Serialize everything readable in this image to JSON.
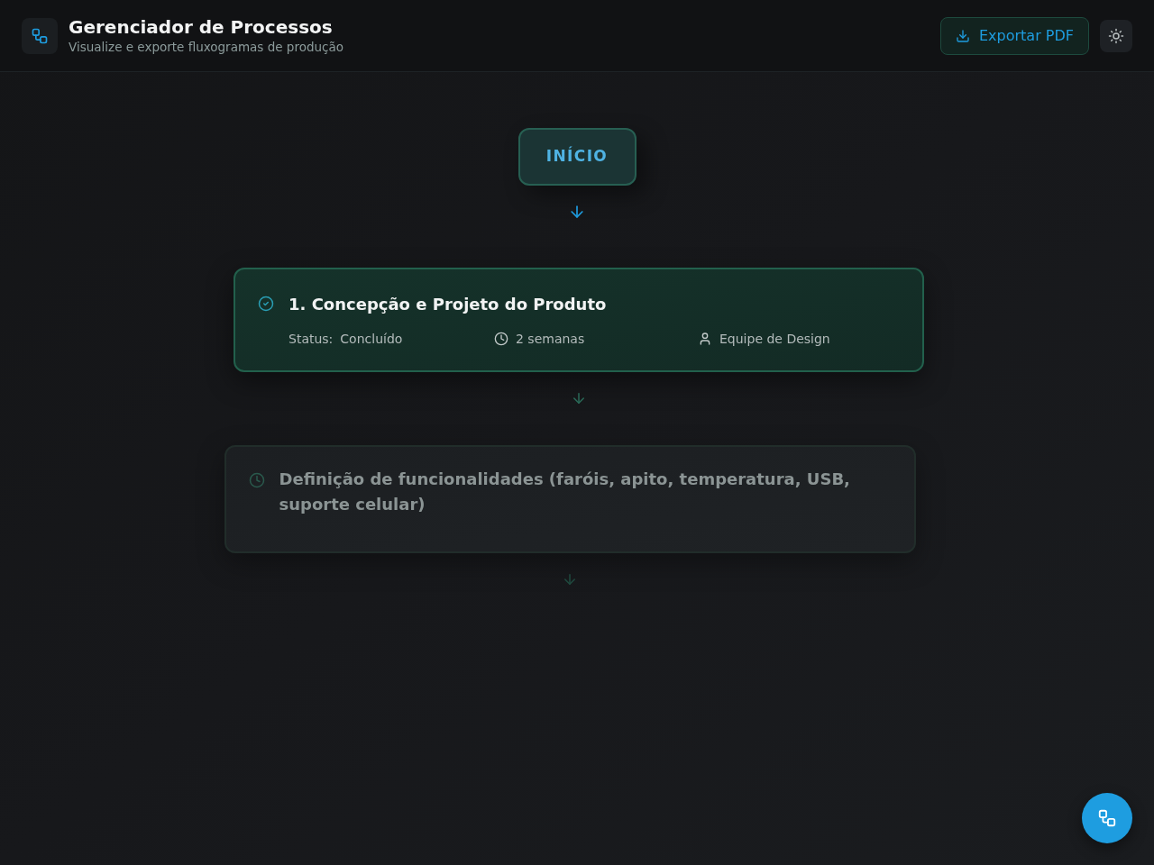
{
  "header": {
    "title": "Gerenciador de Processos",
    "subtitle": "Visualize e exporte fluxogramas de produção",
    "export_button": "Exportar PDF"
  },
  "flow": {
    "start": "INÍCIO",
    "steps": [
      {
        "title": "1. Concepção e Projeto do Produto",
        "completed": true,
        "status_label": "Status:",
        "status": "Concluído",
        "duration": "2 semanas",
        "team": "Equipe de Design"
      },
      {
        "title": "Definição de funcionalidades (faróis, apito, temperatura, USB, suporte celular)",
        "completed": false
      }
    ]
  }
}
